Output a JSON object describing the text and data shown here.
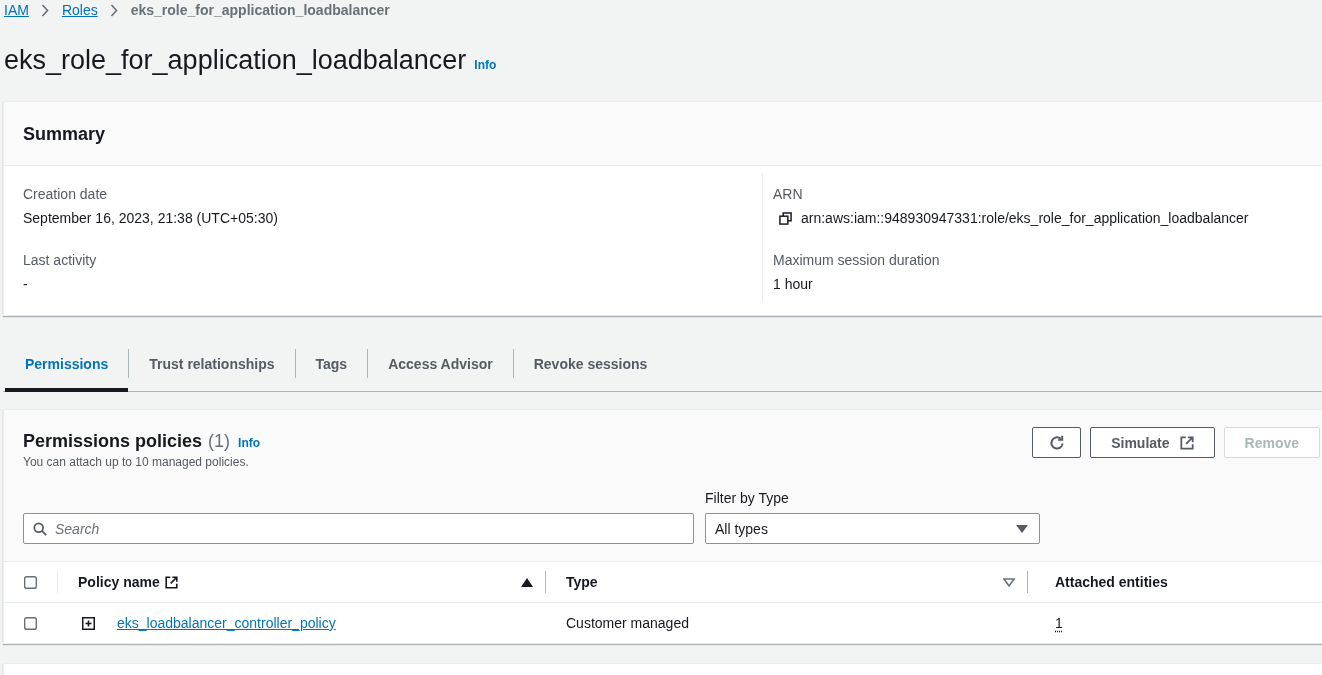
{
  "breadcrumbs": [
    {
      "label": "IAM",
      "kind": "link"
    },
    {
      "label": "Roles",
      "kind": "link"
    },
    {
      "label": "eks_role_for_application_loadbalancer",
      "kind": "current"
    }
  ],
  "header": {
    "title": "eks_role_for_application_loadbalancer",
    "info": "Info"
  },
  "summary": {
    "title": "Summary",
    "columns": [
      {
        "fields": [
          {
            "label": "Creation date",
            "value": "September 16, 2023, 21:38 (UTC+05:30)",
            "kind": "plain"
          },
          {
            "label": "Last activity",
            "value": "-",
            "kind": "plain"
          }
        ]
      },
      {
        "fields": [
          {
            "label": "ARN",
            "value": "arn:aws:iam::948930947331:role/eks_role_for_application_loadbalancer",
            "kind": "copyable"
          },
          {
            "label": "Maximum session duration",
            "value": "1 hour",
            "kind": "plain"
          }
        ]
      }
    ]
  },
  "tabs": [
    {
      "label": "Permissions",
      "selected": true
    },
    {
      "label": "Trust relationships",
      "selected": false
    },
    {
      "label": "Tags",
      "selected": false
    },
    {
      "label": "Access Advisor",
      "selected": false
    },
    {
      "label": "Revoke sessions",
      "selected": false
    }
  ],
  "policies": {
    "title": "Permissions policies",
    "count": "(1)",
    "info": "Info",
    "description": "You can attach up to 10 managed policies.",
    "actions": [
      {
        "kind": "refresh",
        "disabled": false
      },
      {
        "kind": "external",
        "label": "Simulate",
        "disabled": false
      },
      {
        "kind": "text",
        "label": "Remove",
        "disabled": true
      }
    ],
    "search": {
      "placeholder": "Search"
    },
    "filter": {
      "label": "Filter by Type",
      "value": "All types"
    },
    "table": {
      "select_all_checked": false,
      "columns": [
        {
          "label": "Policy name",
          "external_link": true,
          "sortable": true,
          "sorted": true
        },
        {
          "label": "Type",
          "external_link": false,
          "sortable": true,
          "sorted": false
        },
        {
          "label": "Attached entities",
          "external_link": false,
          "sortable": false,
          "sorted": false
        }
      ],
      "rows": [
        {
          "checked": false,
          "expanded": false,
          "name": "eks_loadbalancer_controller_policy",
          "type": "Customer managed",
          "attached_entities": "1"
        }
      ]
    }
  }
}
